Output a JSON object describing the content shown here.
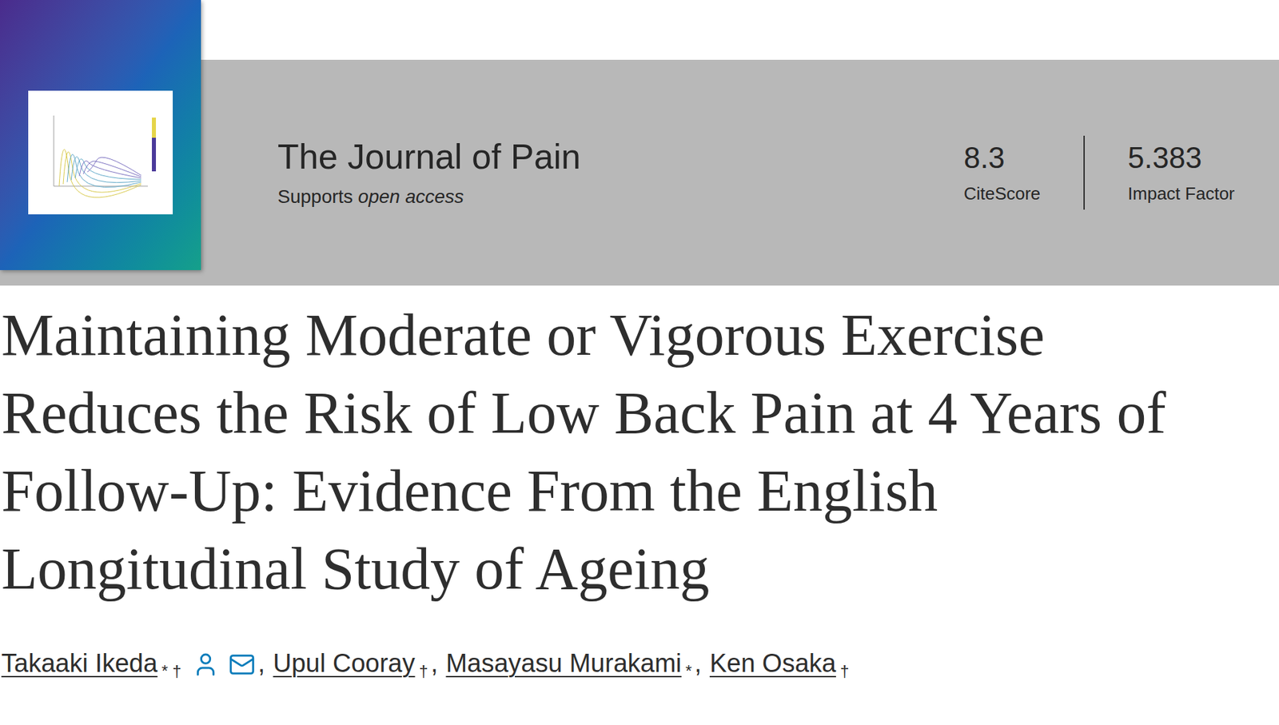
{
  "journal": {
    "name": "The Journal of Pain",
    "access_prefix": "Supports",
    "access_emphasis": "open access"
  },
  "metrics": [
    {
      "value": "8.3",
      "label": "CiteScore"
    },
    {
      "value": "5.383",
      "label": "Impact Factor"
    }
  ],
  "article": {
    "title_lines": [
      "Maintaining Moderate or Vigorous Exercise",
      "Reduces the Risk of Low Back Pain at 4 Years of",
      "Follow-Up: Evidence From the English",
      "Longitudinal Study of Ageing"
    ]
  },
  "authors": [
    {
      "name": "Takaaki Ikeda",
      "marks": "* †",
      "has_contact_icons": true
    },
    {
      "name": "Upul Cooray",
      "marks": "†",
      "has_contact_icons": false
    },
    {
      "name": "Masayasu Murakami",
      "marks": "*",
      "has_contact_icons": false
    },
    {
      "name": "Ken Osaka",
      "marks": "†",
      "has_contact_icons": false
    }
  ],
  "author_separator": ","
}
